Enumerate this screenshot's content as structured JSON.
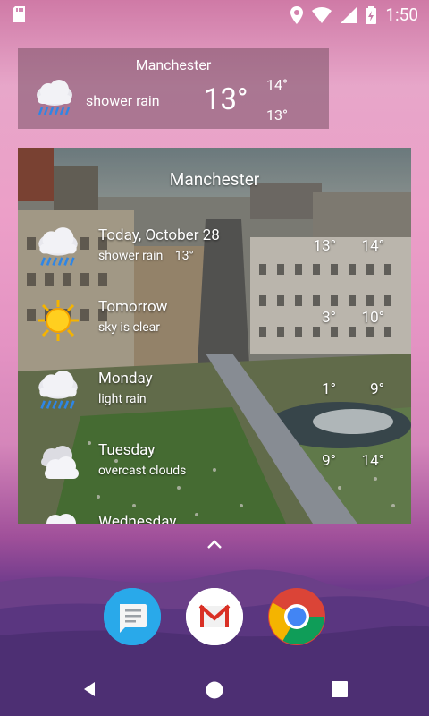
{
  "status": {
    "time": "1:50",
    "icons": [
      "sd-card-icon",
      "location-icon",
      "wifi-icon",
      "signal-icon",
      "battery-icon"
    ]
  },
  "small_widget": {
    "city": "Manchester",
    "description": "shower rain",
    "temperature": "13°",
    "high": "14°",
    "low": "13°",
    "icon": "shower-rain-icon"
  },
  "big_widget": {
    "city": "Manchester",
    "rows": [
      {
        "day": "Today, October 28",
        "description": "shower rain",
        "current": "13°",
        "low": "13°",
        "high": "14°",
        "icon": "shower-rain-icon"
      },
      {
        "day": "Tomorrow",
        "description": "sky is clear",
        "low": "3°",
        "high": "10°",
        "icon": "sun-icon"
      },
      {
        "day": "Monday",
        "description": "light rain",
        "low": "1°",
        "high": "9°",
        "icon": "rain-icon"
      },
      {
        "day": "Tuesday",
        "description": "overcast clouds",
        "low": "9°",
        "high": "14°",
        "icon": "clouds-icon"
      },
      {
        "day": "Wednesday",
        "description": "",
        "low": "",
        "high": "",
        "icon": "clouds-icon"
      }
    ]
  },
  "dock": {
    "apps": [
      {
        "name": "Messages",
        "icon": "messages-icon"
      },
      {
        "name": "Gmail",
        "icon": "gmail-icon"
      },
      {
        "name": "Chrome",
        "icon": "chrome-icon"
      }
    ]
  },
  "navigation": {
    "back": "back-icon",
    "home": "home-icon",
    "recents": "recents-icon"
  },
  "colors": {
    "widget_bg": "#8a5a78",
    "accent_blue": "#2196f3",
    "gmail_red": "#d93025"
  }
}
